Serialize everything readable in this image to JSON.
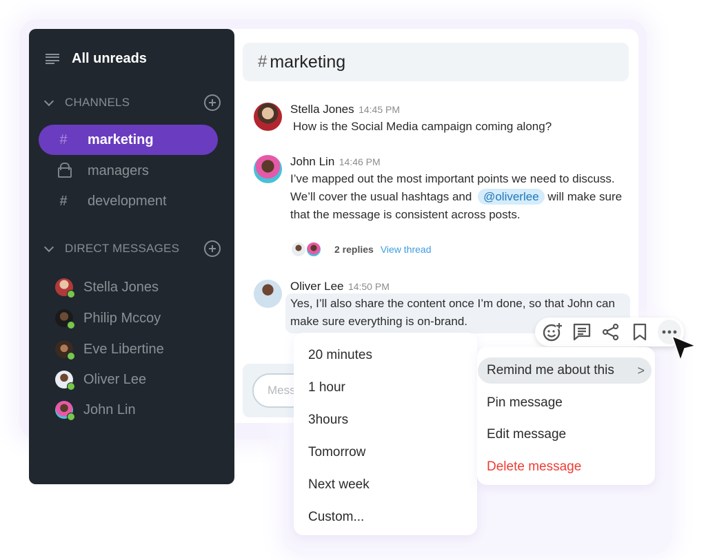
{
  "sidebar": {
    "all_unreads": "All unreads",
    "channels_heading": "CHANNELS",
    "channels": [
      {
        "name": "marketing",
        "icon": "hash-icon",
        "active": true
      },
      {
        "name": "managers",
        "icon": "lock-icon",
        "active": false
      },
      {
        "name": "development",
        "icon": "hash-icon",
        "active": false
      }
    ],
    "dm_heading": "DIRECT MESSAGES",
    "direct_messages": [
      {
        "name": "Stella Jones",
        "status": "online"
      },
      {
        "name": "Philip Mccoy",
        "status": "online"
      },
      {
        "name": "Eve Libertine",
        "status": "online"
      },
      {
        "name": "Oliver Lee",
        "status": "online"
      },
      {
        "name": "John Lin",
        "status": "online"
      }
    ]
  },
  "channel_header": {
    "hash": "#",
    "name": "marketing"
  },
  "messages": [
    {
      "author": "Stella Jones",
      "time": "14:45 PM",
      "text": "How is the Social Media campaign coming along?"
    },
    {
      "author": "John Lin",
      "time": "14:46 PM",
      "text_before": "I’ve mapped out the most important points we need to discuss. We’ll cover the usual hashtags and",
      "mention": "@oliverlee",
      "text_after": "will make sure that the message is consistent across posts."
    },
    {
      "author": "Oliver Lee",
      "time": "14:50 PM",
      "text": "Yes, I’ll also share the content once I’m done, so that John can make sure everything is on-brand."
    }
  ],
  "thread": {
    "replies": "2 replies",
    "view_thread": "View thread"
  },
  "composer": {
    "placeholder": "Message"
  },
  "toolbar": {
    "actions": [
      "add-reaction",
      "reply-in-thread",
      "share",
      "bookmark",
      "more-actions"
    ]
  },
  "action_menu": {
    "items": [
      "Remind me about this",
      "Pin message",
      "Edit message",
      "Delete message"
    ],
    "submenu_arrow": ">"
  },
  "remind_menu": {
    "items": [
      "20 minutes",
      "1 hour",
      "3hours",
      "Tomorrow",
      "Next week",
      "Custom..."
    ]
  },
  "colors": {
    "sidebar_bg": "#20272e",
    "active_channel": "#6a3cbf",
    "online": "#76c74a",
    "mention_bg": "#d4ecfb",
    "link": "#3b9de0",
    "danger": "#ee3b32"
  }
}
